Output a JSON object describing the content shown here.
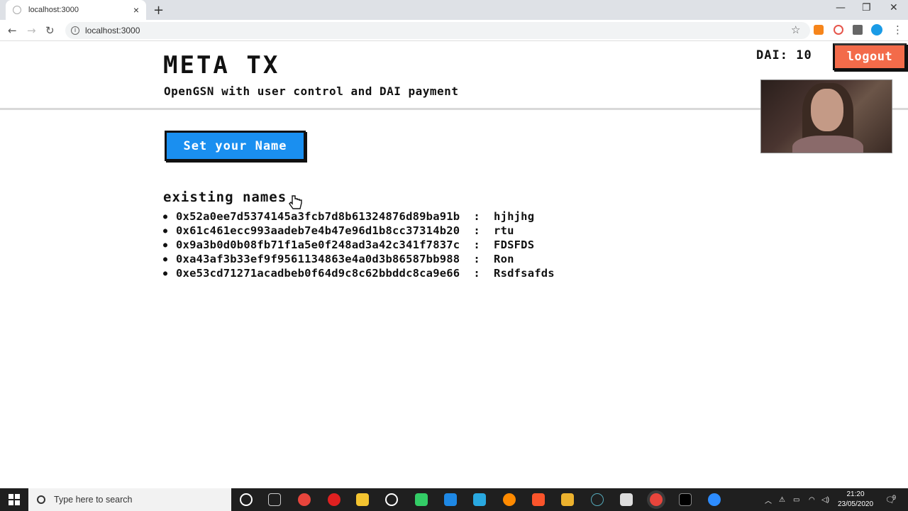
{
  "browser": {
    "tab_title": "localhost:3000",
    "address": "localhost:3000",
    "new_tab_symbol": "+",
    "tab_close_symbol": "×",
    "window_controls": [
      "—",
      "❐",
      "✕"
    ],
    "nav": {
      "back": "←",
      "forward": "→",
      "reload": "↻"
    },
    "extensions": [
      "star-icon",
      "metamask-icon",
      "extension-icon",
      "puzzle-icon",
      "profile-icon",
      "menu-icon"
    ]
  },
  "app": {
    "title": "META TX",
    "subtitle": "OpenGSN with user control and DAI payment",
    "dai_label": "DAI:",
    "dai_value": "10",
    "logout_label": "logout",
    "set_name_label": "Set your Name",
    "existing_heading": "existing names",
    "names": [
      {
        "address": "0x52a0ee7d5374145a3fcb7d8b61324876d89ba91b",
        "separator": ":",
        "name": "hjhjhg"
      },
      {
        "address": "0x61c461ecc993aadeb7e4b47e96d1b8cc37314b20",
        "separator": ":",
        "name": "rtu"
      },
      {
        "address": "0x9a3b0d0b08fb71f1a5e0f248ad3a42c341f7837c",
        "separator": ":",
        "name": "FDSFDS"
      },
      {
        "address": "0xa43af3b33ef9f9561134863e4a0d3b86587bb988",
        "separator": ":",
        "name": "Ron"
      },
      {
        "address": "0xe53cd71271acadbeb0f64d9c8c62bbddc8ca9e66",
        "separator": ":",
        "name": "Rsdfsafds"
      }
    ]
  },
  "taskbar": {
    "search_placeholder": "Type here to search",
    "time": "21:20",
    "date": "23/05/2020",
    "notifications": "9"
  },
  "colors": {
    "logout_bg": "#f36b4a",
    "button_blue": "#1a8ff0"
  }
}
